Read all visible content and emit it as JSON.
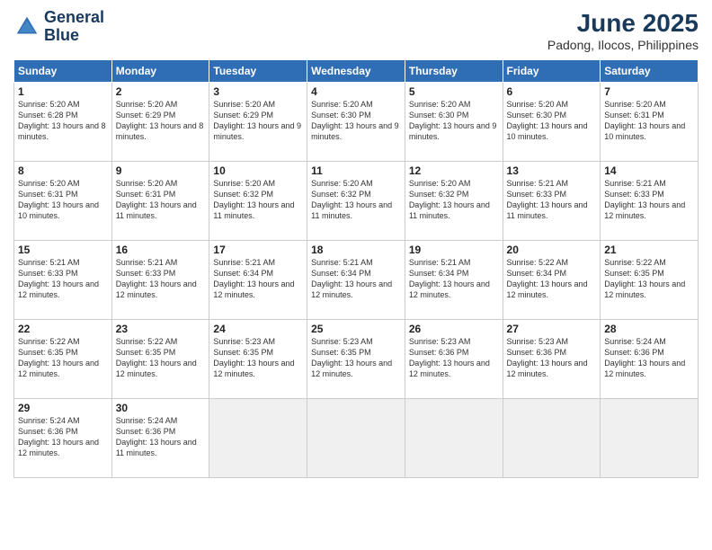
{
  "logo": {
    "line1": "General",
    "line2": "Blue"
  },
  "title": "June 2025",
  "subtitle": "Padong, Ilocos, Philippines",
  "days_of_week": [
    "Sunday",
    "Monday",
    "Tuesday",
    "Wednesday",
    "Thursday",
    "Friday",
    "Saturday"
  ],
  "weeks": [
    [
      {
        "num": "1",
        "sunrise": "5:20 AM",
        "sunset": "6:28 PM",
        "daylight": "13 hours and 8 minutes."
      },
      {
        "num": "2",
        "sunrise": "5:20 AM",
        "sunset": "6:29 PM",
        "daylight": "13 hours and 8 minutes."
      },
      {
        "num": "3",
        "sunrise": "5:20 AM",
        "sunset": "6:29 PM",
        "daylight": "13 hours and 9 minutes."
      },
      {
        "num": "4",
        "sunrise": "5:20 AM",
        "sunset": "6:30 PM",
        "daylight": "13 hours and 9 minutes."
      },
      {
        "num": "5",
        "sunrise": "5:20 AM",
        "sunset": "6:30 PM",
        "daylight": "13 hours and 9 minutes."
      },
      {
        "num": "6",
        "sunrise": "5:20 AM",
        "sunset": "6:30 PM",
        "daylight": "13 hours and 10 minutes."
      },
      {
        "num": "7",
        "sunrise": "5:20 AM",
        "sunset": "6:31 PM",
        "daylight": "13 hours and 10 minutes."
      }
    ],
    [
      {
        "num": "8",
        "sunrise": "5:20 AM",
        "sunset": "6:31 PM",
        "daylight": "13 hours and 10 minutes."
      },
      {
        "num": "9",
        "sunrise": "5:20 AM",
        "sunset": "6:31 PM",
        "daylight": "13 hours and 11 minutes."
      },
      {
        "num": "10",
        "sunrise": "5:20 AM",
        "sunset": "6:32 PM",
        "daylight": "13 hours and 11 minutes."
      },
      {
        "num": "11",
        "sunrise": "5:20 AM",
        "sunset": "6:32 PM",
        "daylight": "13 hours and 11 minutes."
      },
      {
        "num": "12",
        "sunrise": "5:20 AM",
        "sunset": "6:32 PM",
        "daylight": "13 hours and 11 minutes."
      },
      {
        "num": "13",
        "sunrise": "5:21 AM",
        "sunset": "6:33 PM",
        "daylight": "13 hours and 11 minutes."
      },
      {
        "num": "14",
        "sunrise": "5:21 AM",
        "sunset": "6:33 PM",
        "daylight": "13 hours and 12 minutes."
      }
    ],
    [
      {
        "num": "15",
        "sunrise": "5:21 AM",
        "sunset": "6:33 PM",
        "daylight": "13 hours and 12 minutes."
      },
      {
        "num": "16",
        "sunrise": "5:21 AM",
        "sunset": "6:33 PM",
        "daylight": "13 hours and 12 minutes."
      },
      {
        "num": "17",
        "sunrise": "5:21 AM",
        "sunset": "6:34 PM",
        "daylight": "13 hours and 12 minutes."
      },
      {
        "num": "18",
        "sunrise": "5:21 AM",
        "sunset": "6:34 PM",
        "daylight": "13 hours and 12 minutes."
      },
      {
        "num": "19",
        "sunrise": "5:21 AM",
        "sunset": "6:34 PM",
        "daylight": "13 hours and 12 minutes."
      },
      {
        "num": "20",
        "sunrise": "5:22 AM",
        "sunset": "6:34 PM",
        "daylight": "13 hours and 12 minutes."
      },
      {
        "num": "21",
        "sunrise": "5:22 AM",
        "sunset": "6:35 PM",
        "daylight": "13 hours and 12 minutes."
      }
    ],
    [
      {
        "num": "22",
        "sunrise": "5:22 AM",
        "sunset": "6:35 PM",
        "daylight": "13 hours and 12 minutes."
      },
      {
        "num": "23",
        "sunrise": "5:22 AM",
        "sunset": "6:35 PM",
        "daylight": "13 hours and 12 minutes."
      },
      {
        "num": "24",
        "sunrise": "5:23 AM",
        "sunset": "6:35 PM",
        "daylight": "13 hours and 12 minutes."
      },
      {
        "num": "25",
        "sunrise": "5:23 AM",
        "sunset": "6:35 PM",
        "daylight": "13 hours and 12 minutes."
      },
      {
        "num": "26",
        "sunrise": "5:23 AM",
        "sunset": "6:36 PM",
        "daylight": "13 hours and 12 minutes."
      },
      {
        "num": "27",
        "sunrise": "5:23 AM",
        "sunset": "6:36 PM",
        "daylight": "13 hours and 12 minutes."
      },
      {
        "num": "28",
        "sunrise": "5:24 AM",
        "sunset": "6:36 PM",
        "daylight": "13 hours and 12 minutes."
      }
    ],
    [
      {
        "num": "29",
        "sunrise": "5:24 AM",
        "sunset": "6:36 PM",
        "daylight": "13 hours and 12 minutes."
      },
      {
        "num": "30",
        "sunrise": "5:24 AM",
        "sunset": "6:36 PM",
        "daylight": "13 hours and 11 minutes."
      },
      null,
      null,
      null,
      null,
      null
    ]
  ]
}
